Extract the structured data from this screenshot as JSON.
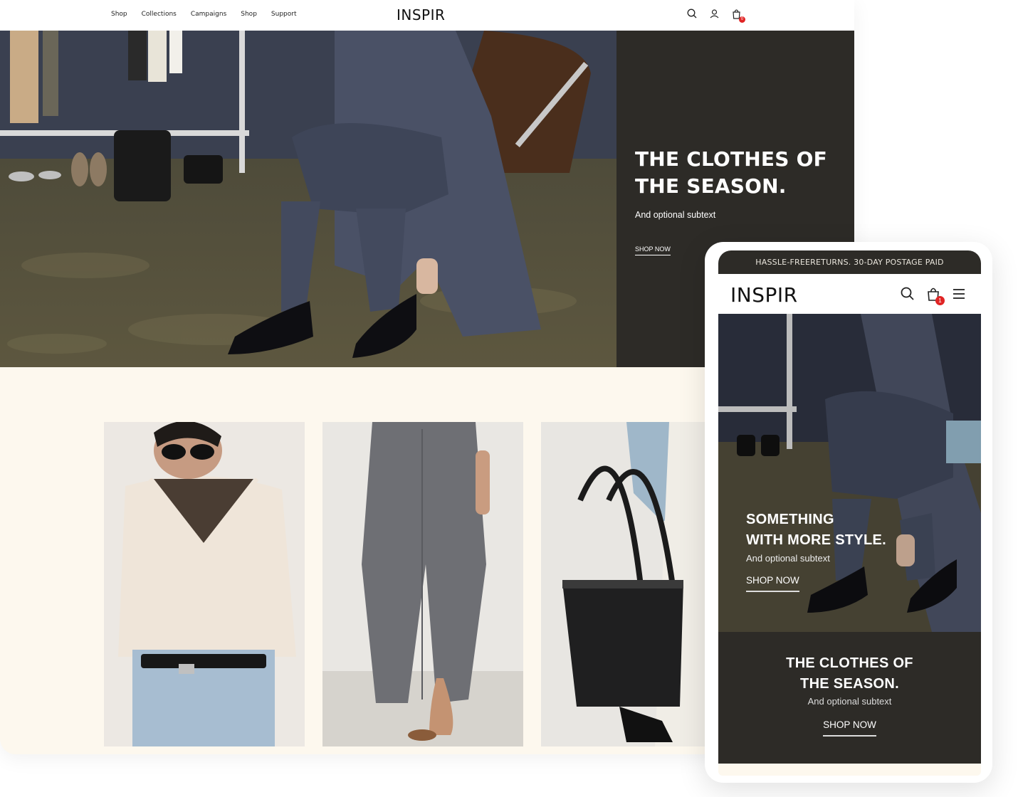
{
  "colors": {
    "hero_dark": "#2d2b27",
    "section_bg": "#fdf8ee",
    "badge_red": "#e02424"
  },
  "desktop": {
    "nav": [
      "Shop",
      "Collections",
      "Campaigns",
      "Shop",
      "Support"
    ],
    "logo": "INSPIR",
    "icons": [
      "search-icon",
      "account-icon",
      "cart-icon"
    ],
    "cart_count": "0",
    "hero": {
      "title": "THE CLOTHES OF\nTHE SEASON.",
      "subtitle": "And optional subtext",
      "cta": "SHOP NOW"
    },
    "cards": [
      "sweater-look-photo",
      "wide-trousers-photo",
      "tote-bag-photo"
    ]
  },
  "mobile": {
    "announcement": "HASSLE-FREERETURNS. 30-DAY POSTAGE PAID",
    "logo": "INSPIR",
    "icons": [
      "search-icon",
      "cart-icon",
      "menu-icon"
    ],
    "cart_count": "1",
    "hero": {
      "title": "SOMETHING\nWITH MORE STYLE.",
      "subtitle": "And optional subtext",
      "cta": "SHOP NOW"
    },
    "promo": {
      "title": "THE CLOTHES OF\nTHE SEASON.",
      "subtitle": "And optional subtext",
      "cta": "SHOP NOW"
    }
  }
}
